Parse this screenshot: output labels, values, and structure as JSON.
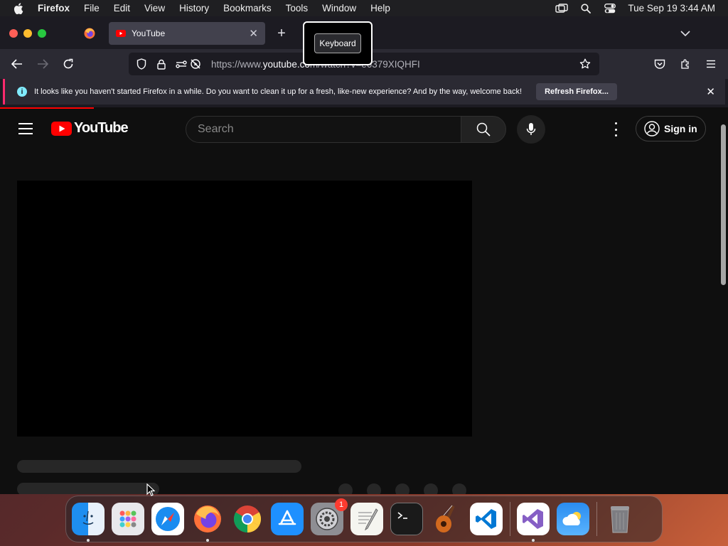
{
  "menubar": {
    "app_name": "Firefox",
    "items": [
      "File",
      "Edit",
      "View",
      "History",
      "Bookmarks",
      "Tools",
      "Window",
      "Help"
    ],
    "clock": "Tue Sep 19  3:44 AM"
  },
  "tabs": {
    "active_title": "YouTube"
  },
  "tooltip": {
    "text": "Keyboard"
  },
  "urlbar": {
    "url_prefix": "https://www.",
    "url_domain": "youtube.co",
    "url_suffix": "m/watch?v=e6379XIQHFI"
  },
  "notification": {
    "message": "It looks like you haven't started Firefox in a while. Do you want to clean it up for a fresh, like-new experience? And by the way, welcome back!",
    "button_label": "Refresh Firefox..."
  },
  "youtube": {
    "logo_text": "YouTube",
    "search_placeholder": "Search",
    "signin_label": "Sign in"
  },
  "dock": {
    "system_settings_badge": "1"
  },
  "colors": {
    "youtube_red": "#ff0000",
    "notification_accent": "#ff2a6d",
    "info_icon": "#80ebff"
  }
}
